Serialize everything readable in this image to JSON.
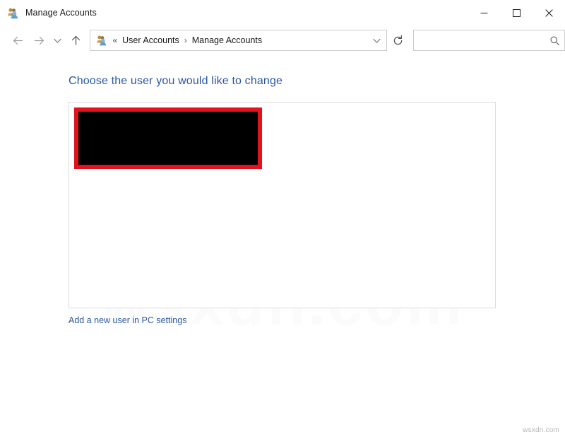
{
  "window": {
    "title": "Manage Accounts",
    "app_icon": "user-accounts-icon",
    "controls": {
      "minimize": "minimize-icon",
      "maximize": "maximize-icon",
      "close": "close-icon"
    }
  },
  "navigation": {
    "back": "back-arrow-icon",
    "forward": "forward-arrow-icon",
    "recent": "chevron-down-icon",
    "up": "up-arrow-icon"
  },
  "address_bar": {
    "icon": "user-accounts-icon",
    "overflow": "«",
    "separator": "›",
    "crumbs": [
      {
        "label": "User Accounts"
      },
      {
        "label": "Manage Accounts"
      }
    ],
    "dropdown": "chevron-down-icon",
    "refresh": "refresh-icon"
  },
  "search": {
    "value": "",
    "placeholder": "",
    "icon": "search-icon"
  },
  "main": {
    "heading": "Choose the user you would like to change",
    "redacted_account": "",
    "add_user_link": "Add a new user in PC settings"
  },
  "watermark": {
    "background": "wsxdn.com",
    "corner": "wsxdn.com"
  },
  "colors": {
    "heading_blue": "#2a57a0",
    "link_blue": "#2a57a0",
    "redaction_border_red": "#e3121f",
    "redaction_fill": "#000000",
    "panel_border": "#dcdcdc",
    "field_border": "#cccccc"
  }
}
